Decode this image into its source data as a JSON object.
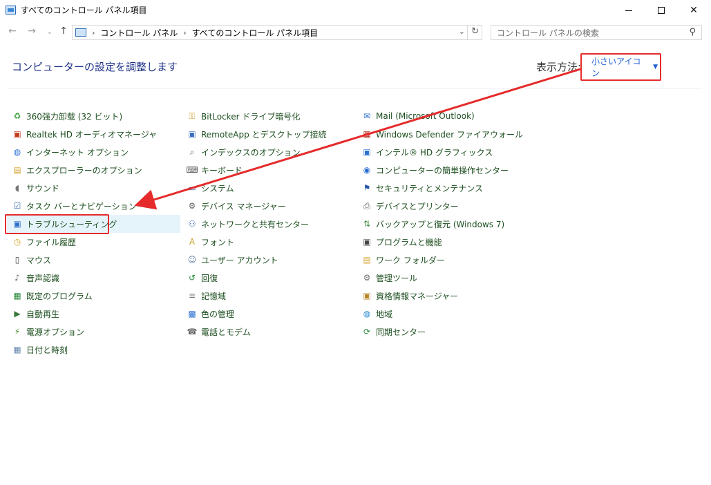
{
  "window": {
    "title": "すべてのコントロール パネル項目",
    "minimize_icon": "minimize-icon",
    "maximize_icon": "maximize-icon",
    "close_icon": "close-icon",
    "close_glyph": "✕"
  },
  "nav": {
    "back_glyph": "←",
    "forward_glyph": "→",
    "recent_glyph": "⌄",
    "up_glyph": "↑",
    "address": {
      "crumb_1": "コントロール パネル",
      "crumb_2": "すべてのコントロール パネル項目",
      "separator": "›",
      "dropdown_glyph": "⌄",
      "refresh_glyph": "↻"
    },
    "search": {
      "placeholder": "コントロール パネルの検索",
      "icon_glyph": "⚲"
    }
  },
  "header": {
    "title": "コンピューターの設定を調整します",
    "view_by_label": "表示方法:",
    "view_by_value": "小さいアイコン",
    "caret": "▼"
  },
  "items": {
    "col1": [
      {
        "label": "360强力卸载 (32 ビット)",
        "icon": "uninstall-icon",
        "glyph": "♻",
        "color": "#3a9b3a"
      },
      {
        "label": "Realtek HD オーディオマネージャ",
        "icon": "realtek-audio-icon",
        "glyph": "▣",
        "color": "#c23a1c"
      },
      {
        "label": "インターネット オプション",
        "icon": "internet-options-icon",
        "glyph": "◍",
        "color": "#2a6fd0"
      },
      {
        "label": "エクスプローラーのオプション",
        "icon": "folder-options-icon",
        "glyph": "▤",
        "color": "#d7a531"
      },
      {
        "label": "サウンド",
        "icon": "speaker-icon",
        "glyph": "◖",
        "color": "#777777"
      },
      {
        "label": "タスク バーとナビゲーション",
        "icon": "taskbar-icon",
        "glyph": "☑",
        "color": "#3c6fb1"
      },
      {
        "label": "トラブルシューティング",
        "icon": "troubleshooting-icon",
        "glyph": "▣",
        "color": "#2d6ec7"
      },
      {
        "label": "ファイル履歴",
        "icon": "file-history-icon",
        "glyph": "◷",
        "color": "#cfa21d"
      },
      {
        "label": "マウス",
        "icon": "mouse-icon",
        "glyph": "▯",
        "color": "#444444"
      },
      {
        "label": "音声認識",
        "icon": "microphone-icon",
        "glyph": "♪",
        "color": "#666666"
      },
      {
        "label": "既定のプログラム",
        "icon": "default-programs-icon",
        "glyph": "▦",
        "color": "#2b8a3e"
      },
      {
        "label": "自動再生",
        "icon": "autoplay-icon",
        "glyph": "▶",
        "color": "#3a7a3a"
      },
      {
        "label": "電源オプション",
        "icon": "power-options-icon",
        "glyph": "⚡",
        "color": "#4a8a2a"
      },
      {
        "label": "日付と時刻",
        "icon": "date-time-icon",
        "glyph": "▦",
        "color": "#6a8ab0"
      }
    ],
    "col2": [
      {
        "label": "BitLocker ドライブ暗号化",
        "icon": "bitlocker-icon",
        "glyph": "⚿",
        "color": "#c79a22"
      },
      {
        "label": "RemoteApp とデスクトップ接続",
        "icon": "remoteapp-icon",
        "glyph": "▣",
        "color": "#3a6fc2"
      },
      {
        "label": "インデックスのオプション",
        "icon": "indexing-icon",
        "glyph": "⌕",
        "color": "#555555"
      },
      {
        "label": "キーボード",
        "icon": "keyboard-icon",
        "glyph": "⌨",
        "color": "#555555"
      },
      {
        "label": "システム",
        "icon": "system-icon",
        "glyph": "▭",
        "color": "#3a6fc2"
      },
      {
        "label": "デバイス マネージャー",
        "icon": "device-manager-icon",
        "glyph": "⚙",
        "color": "#666666"
      },
      {
        "label": "ネットワークと共有センター",
        "icon": "network-icon",
        "glyph": "⚇",
        "color": "#3a6fc2"
      },
      {
        "label": "フォント",
        "icon": "fonts-icon",
        "glyph": "A",
        "color": "#c7a22a"
      },
      {
        "label": "ユーザー アカウント",
        "icon": "user-accounts-icon",
        "glyph": "☺",
        "color": "#5a7aa0"
      },
      {
        "label": "回復",
        "icon": "recovery-icon",
        "glyph": "↺",
        "color": "#2b8a3e"
      },
      {
        "label": "記憶域",
        "icon": "storage-icon",
        "glyph": "≡",
        "color": "#777777"
      },
      {
        "label": "色の管理",
        "icon": "color-management-icon",
        "glyph": "▩",
        "color": "#2a6fd0"
      },
      {
        "label": "電話とモデム",
        "icon": "phone-modem-icon",
        "glyph": "☎",
        "color": "#666666"
      }
    ],
    "col3": [
      {
        "label": "Mail (Microsoft Outlook)",
        "icon": "mail-icon",
        "glyph": "✉",
        "color": "#2a6fd0"
      },
      {
        "label": "Windows Defender ファイアウォール",
        "icon": "firewall-icon",
        "glyph": "▦",
        "color": "#b23a2a"
      },
      {
        "label": "インテル® HD グラフィックス",
        "icon": "intel-graphics-icon",
        "glyph": "▣",
        "color": "#2a6fd0"
      },
      {
        "label": "コンピューターの簡単操作センター",
        "icon": "ease-of-access-icon",
        "glyph": "◉",
        "color": "#2a6fd0"
      },
      {
        "label": "セキュリティとメンテナンス",
        "icon": "flag-icon",
        "glyph": "⚑",
        "color": "#2a5aa8"
      },
      {
        "label": "デバイスとプリンター",
        "icon": "devices-printers-icon",
        "glyph": "⎙",
        "color": "#555555"
      },
      {
        "label": "バックアップと復元 (Windows 7)",
        "icon": "backup-restore-icon",
        "glyph": "⇅",
        "color": "#3a8a3a"
      },
      {
        "label": "プログラムと機能",
        "icon": "programs-features-icon",
        "glyph": "▣",
        "color": "#444444"
      },
      {
        "label": "ワーク フォルダー",
        "icon": "work-folders-icon",
        "glyph": "▤",
        "color": "#d7a531"
      },
      {
        "label": "管理ツール",
        "icon": "admin-tools-icon",
        "glyph": "⚙",
        "color": "#777777"
      },
      {
        "label": "資格情報マネージャー",
        "icon": "credential-manager-icon",
        "glyph": "▣",
        "color": "#b8862a"
      },
      {
        "label": "地域",
        "icon": "region-icon",
        "glyph": "◍",
        "color": "#2a8ad0"
      },
      {
        "label": "同期センター",
        "icon": "sync-center-icon",
        "glyph": "⟳",
        "color": "#2b8a3e"
      }
    ]
  },
  "colors": {
    "heading": "#1e3287",
    "item_text": "#1c4e1f",
    "annotation": "#e52b2b",
    "selection": "#e5f3fb"
  }
}
